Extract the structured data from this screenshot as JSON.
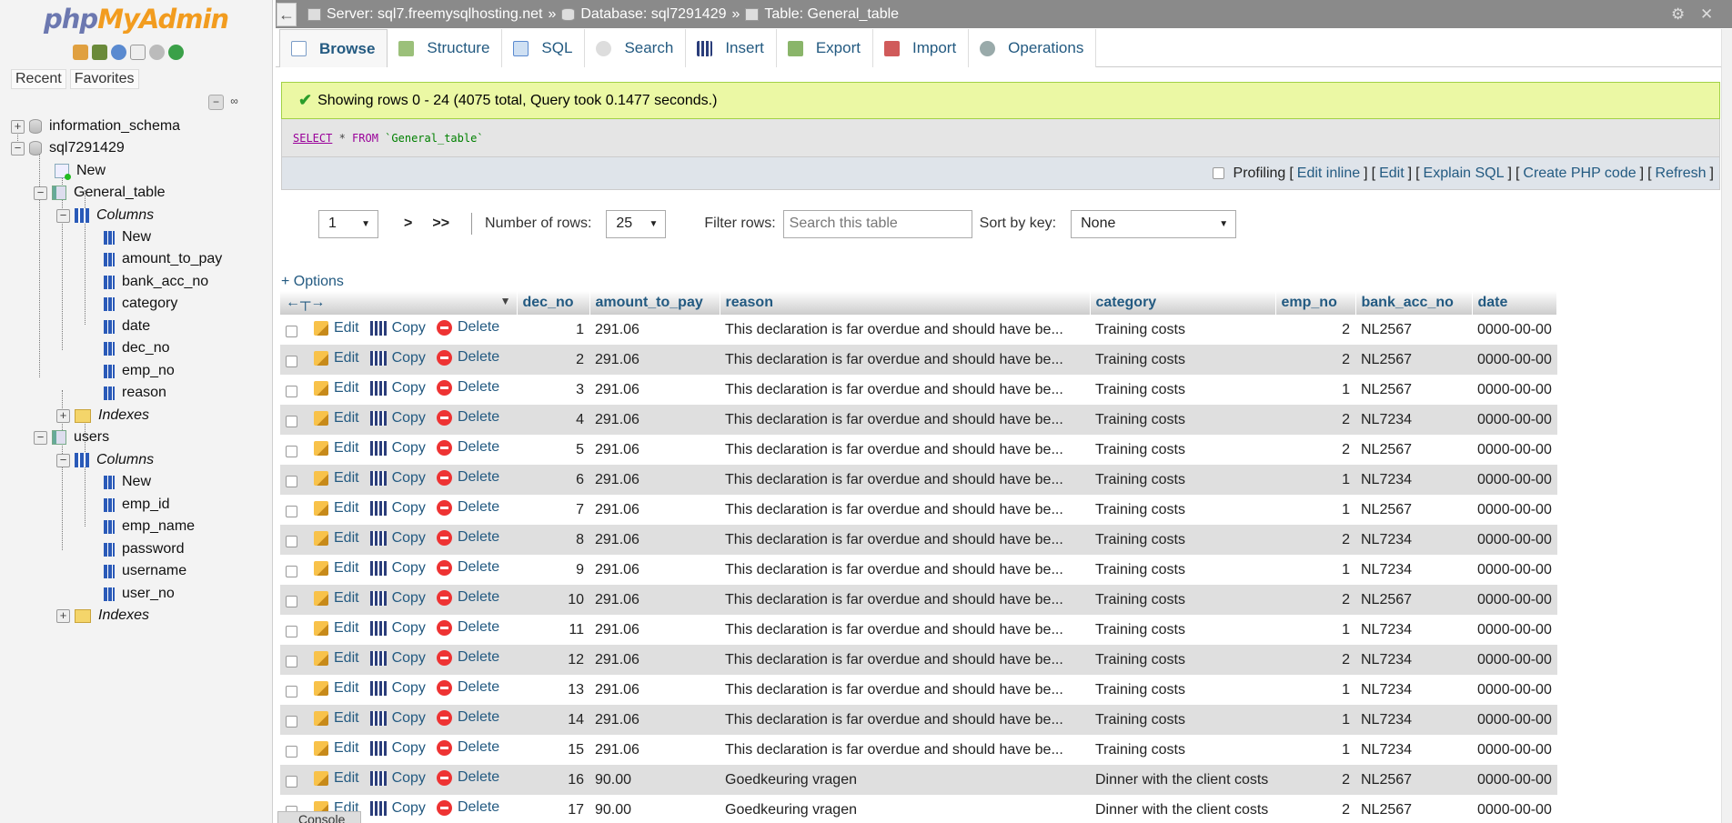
{
  "sidebar": {
    "logo_php": "php",
    "logo_myadmin": "MyAdmin",
    "recent": "Recent",
    "favorites": "Favorites",
    "tree": {
      "db1": "information_schema",
      "db2": "sql7291429",
      "db2_new": "New",
      "table1": "General_table",
      "table1_columns": "Columns",
      "table1_cols": [
        "New",
        "amount_to_pay",
        "bank_acc_no",
        "category",
        "date",
        "dec_no",
        "emp_no",
        "reason"
      ],
      "table1_indexes": "Indexes",
      "table2": "users",
      "table2_columns": "Columns",
      "table2_cols": [
        "New",
        "emp_id",
        "emp_name",
        "password",
        "username",
        "user_no"
      ],
      "table2_indexes": "Indexes"
    }
  },
  "breadcrumb": {
    "server": "Server: sql7.freemysqlhosting.net",
    "database": "Database: sql7291429",
    "table": "Table: General_table",
    "sep": "»"
  },
  "tabs": [
    "Browse",
    "Structure",
    "SQL",
    "Search",
    "Insert",
    "Export",
    "Import",
    "Operations"
  ],
  "message": {
    "success": "Showing rows 0 - 24 (4075 total, Query took 0.1477 seconds.)",
    "sql_select": "SELECT",
    "sql_star": " * ",
    "sql_from": "FROM",
    "sql_table": " `General_table`"
  },
  "sql_actions": {
    "profiling": "Profiling",
    "edit_inline": "Edit inline",
    "edit": "Edit",
    "explain": "Explain SQL",
    "create_php": "Create PHP code",
    "refresh": "Refresh"
  },
  "navigation": {
    "page": "1",
    "next": ">",
    "last": ">>",
    "rows_label": "Number of rows:",
    "rows_value": "25",
    "filter_label": "Filter rows:",
    "filter_placeholder": "Search this table",
    "sort_label": "Sort by key:",
    "sort_value": "None"
  },
  "options_link": "+ Options",
  "table": {
    "columns": [
      "dec_no",
      "amount_to_pay",
      "reason",
      "category",
      "emp_no",
      "bank_acc_no",
      "date"
    ],
    "action_labels": {
      "edit": "Edit",
      "copy": "Copy",
      "delete": "Delete"
    },
    "rows": [
      [
        "1",
        "291.06",
        "This declaration is far overdue and should have be...",
        "Training costs",
        "2",
        "NL2567",
        "0000-00-00"
      ],
      [
        "2",
        "291.06",
        "This declaration is far overdue and should have be...",
        "Training costs",
        "2",
        "NL2567",
        "0000-00-00"
      ],
      [
        "3",
        "291.06",
        "This declaration is far overdue and should have be...",
        "Training costs",
        "1",
        "NL2567",
        "0000-00-00"
      ],
      [
        "4",
        "291.06",
        "This declaration is far overdue and should have be...",
        "Training costs",
        "2",
        "NL7234",
        "0000-00-00"
      ],
      [
        "5",
        "291.06",
        "This declaration is far overdue and should have be...",
        "Training costs",
        "2",
        "NL2567",
        "0000-00-00"
      ],
      [
        "6",
        "291.06",
        "This declaration is far overdue and should have be...",
        "Training costs",
        "1",
        "NL7234",
        "0000-00-00"
      ],
      [
        "7",
        "291.06",
        "This declaration is far overdue and should have be...",
        "Training costs",
        "1",
        "NL2567",
        "0000-00-00"
      ],
      [
        "8",
        "291.06",
        "This declaration is far overdue and should have be...",
        "Training costs",
        "2",
        "NL7234",
        "0000-00-00"
      ],
      [
        "9",
        "291.06",
        "This declaration is far overdue and should have be...",
        "Training costs",
        "1",
        "NL7234",
        "0000-00-00"
      ],
      [
        "10",
        "291.06",
        "This declaration is far overdue and should have be...",
        "Training costs",
        "2",
        "NL2567",
        "0000-00-00"
      ],
      [
        "11",
        "291.06",
        "This declaration is far overdue and should have be...",
        "Training costs",
        "1",
        "NL7234",
        "0000-00-00"
      ],
      [
        "12",
        "291.06",
        "This declaration is far overdue and should have be...",
        "Training costs",
        "2",
        "NL7234",
        "0000-00-00"
      ],
      [
        "13",
        "291.06",
        "This declaration is far overdue and should have be...",
        "Training costs",
        "1",
        "NL7234",
        "0000-00-00"
      ],
      [
        "14",
        "291.06",
        "This declaration is far overdue and should have be...",
        "Training costs",
        "1",
        "NL7234",
        "0000-00-00"
      ],
      [
        "15",
        "291.06",
        "This declaration is far overdue and should have be...",
        "Training costs",
        "1",
        "NL7234",
        "0000-00-00"
      ],
      [
        "16",
        "90.00",
        "Goedkeuring vragen",
        "Dinner with the client costs",
        "2",
        "NL2567",
        "0000-00-00"
      ],
      [
        "17",
        "90.00",
        "Goedkeuring vragen",
        "Dinner with the client costs",
        "2",
        "NL2567",
        "0000-00-00"
      ]
    ]
  },
  "console_label": "Console"
}
